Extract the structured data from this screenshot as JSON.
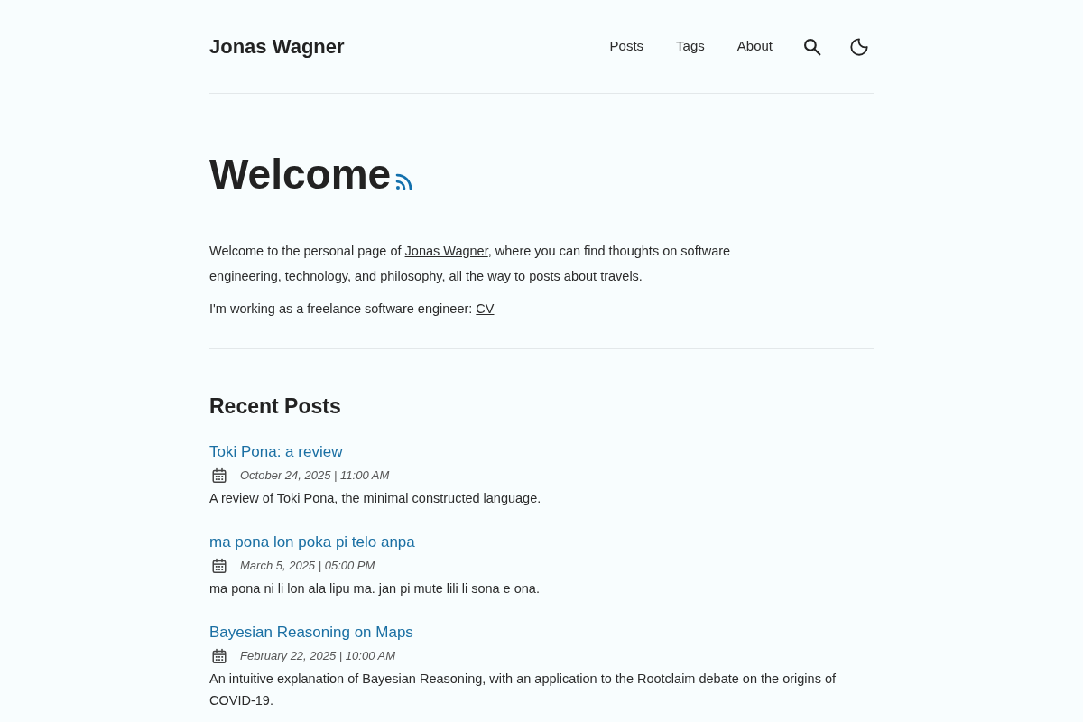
{
  "header": {
    "site_title": "Jonas Wagner",
    "nav": [
      {
        "kind": "link",
        "label": "Posts"
      },
      {
        "kind": "link",
        "label": "Tags"
      },
      {
        "kind": "link",
        "label": "About"
      },
      {
        "kind": "search"
      },
      {
        "kind": "theme"
      }
    ]
  },
  "hero": {
    "title": "Welcome",
    "paragraphs": [
      {
        "before": "Welcome to the personal page of ",
        "link": "Jonas Wagner",
        "after": ", where you can find thoughts on software engineering, technology, and philosophy, all the way to posts about travels."
      },
      {
        "before": "I'm working as a freelance software engineer: ",
        "link": "CV"
      }
    ]
  },
  "recent_posts": {
    "heading": "Recent Posts",
    "posts": [
      {
        "title": "Toki Pona: a review",
        "date": "October 24, 2025 | 11:00 AM",
        "description": "A review of Toki Pona, the minimal constructed language."
      },
      {
        "title": "ma pona lon poka pi telo anpa",
        "date": "March 5, 2025 | 05:00 PM",
        "description": "ma pona ni li lon ala lipu ma. jan pi mute lili li sona e ona."
      },
      {
        "title": "Bayesian Reasoning on Maps",
        "date": "February 22, 2025 | 10:00 AM",
        "description": "An intuitive explanation of Bayesian Reasoning, with an application to the Rootclaim debate on the origins of COVID-19."
      }
    ]
  }
}
